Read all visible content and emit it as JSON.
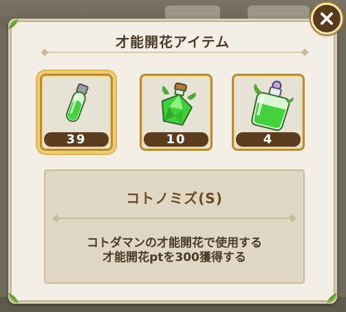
{
  "dialog": {
    "title": "才能開花アイテム",
    "close_icon": "close-x-icon"
  },
  "items": [
    {
      "icon": "small-green-vial-icon",
      "count": "39",
      "selected": true
    },
    {
      "icon": "green-gem-potion-icon",
      "count": "10",
      "selected": false
    },
    {
      "icon": "large-green-bottle-icon",
      "count": "4",
      "selected": false
    }
  ],
  "detail": {
    "name": "コトノミズ(S)",
    "description_line1": "コトダマンの才能開花で使用する",
    "description_line2": "才能開花ptを300獲得する"
  },
  "colors": {
    "frame_gold": "#b58a3a",
    "count_bg": "#5b3d1e",
    "potion_green": "#43d13d",
    "dialog_bg": "#f3efe6"
  }
}
